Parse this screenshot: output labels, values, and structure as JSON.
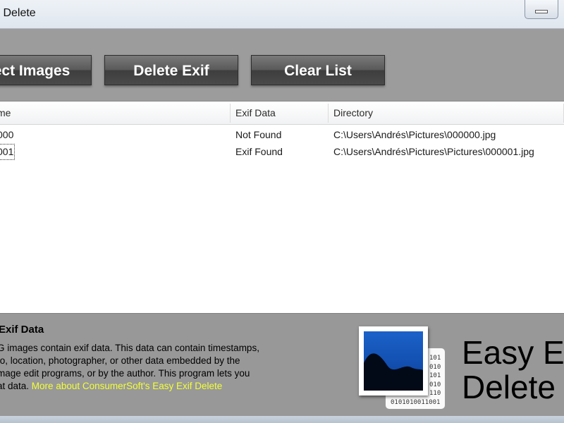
{
  "window": {
    "title": "if Delete"
  },
  "toolbar": {
    "select_label": "ect Images",
    "delete_label": "Delete Exif",
    "clear_label": "Clear List"
  },
  "list": {
    "columns": [
      "me",
      "Exif Data",
      "Directory"
    ],
    "rows": [
      {
        "name": "000",
        "exif": "Not Found",
        "directory": "C:\\Users\\Andrés\\Pictures\\000000.jpg"
      },
      {
        "name": "001",
        "exif": "Exif Found",
        "directory": "C:\\Users\\Andrés\\Pictures\\Pictures\\000001.jpg"
      }
    ]
  },
  "about": {
    "title": "Exif Data",
    "lines": [
      "G images contain exif data. This data can contain timestamps,",
      "fo, location, photographer, or other data embedded by the",
      "mage edit programs, or by the author. This program lets you",
      "at data. "
    ],
    "link": "More about ConsumerSoft's Easy Exif Delete"
  },
  "brand": {
    "line1": "Easy Ex",
    "line2": "Delete",
    "binary_column": [
      "101",
      "010",
      "101",
      "010",
      "110"
    ],
    "binary_row": "0101010011001"
  },
  "icons": {
    "minimize": "minimize-icon",
    "logo": "photo-logo-icon"
  },
  "colors": {
    "button": "#4f4f4f",
    "link": "#f2ff33",
    "panel": "#9c9c9c"
  }
}
